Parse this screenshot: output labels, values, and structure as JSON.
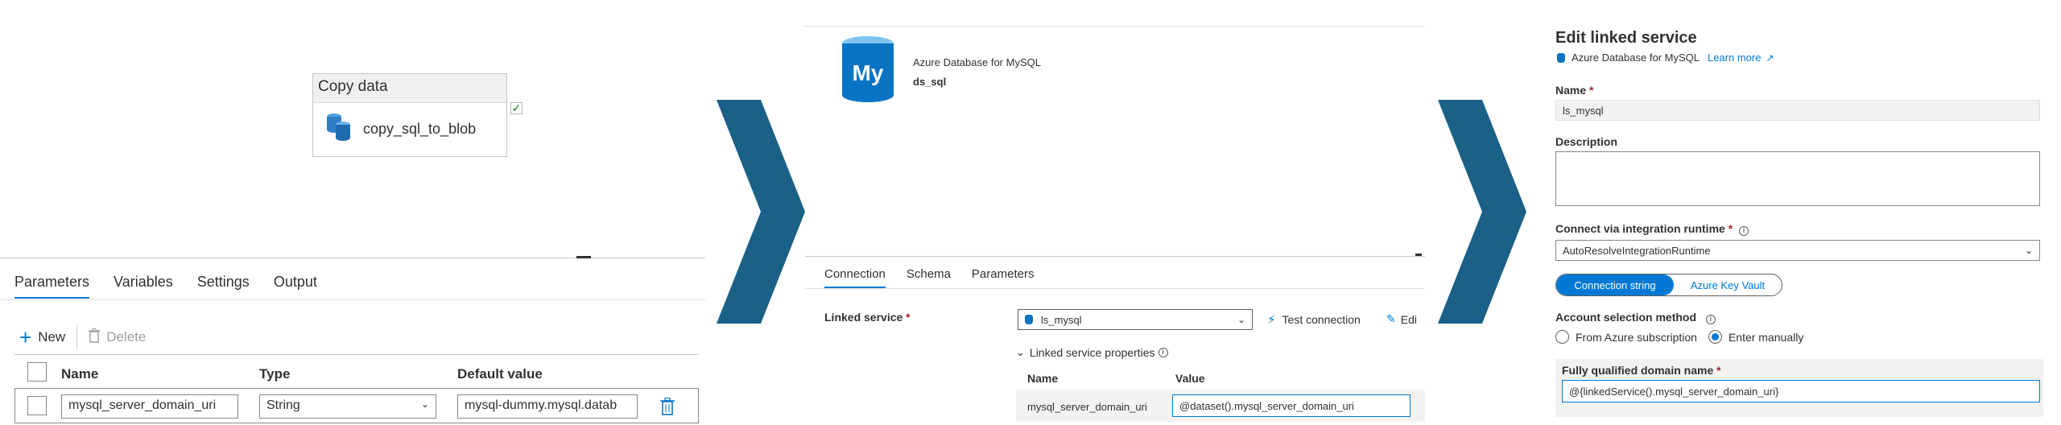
{
  "pipeline": {
    "activity_header": "Copy data",
    "activity_name": "copy_sql_to_blob",
    "status_icon": "check-icon",
    "tabs": [
      "Parameters",
      "Variables",
      "Settings",
      "Output"
    ],
    "toolbar": {
      "new_label": "New",
      "delete_label": "Delete"
    },
    "grid": {
      "headers": [
        "Name",
        "Type",
        "Default value"
      ],
      "row": {
        "name": "mysql_server_domain_uri",
        "type": "String",
        "default": "mysql-dummy.mysql.datab"
      }
    }
  },
  "dataset": {
    "logo_text": "My",
    "type_label": "Azure Database for MySQL",
    "name": "ds_sql",
    "tabs": [
      "Connection",
      "Schema",
      "Parameters"
    ],
    "linked_service_label": "Linked service",
    "linked_service_value": "ls_mysql",
    "test_connection": "Test connection",
    "edit": "Edi",
    "props_toggle": "Linked service properties",
    "props_headers": [
      "Name",
      "Value"
    ],
    "props_row": {
      "name": "mysql_server_domain_uri",
      "value": "@dataset().mysql_server_domain_uri"
    }
  },
  "linked_service": {
    "title": "Edit linked service",
    "type_label": "Azure Database for MySQL",
    "learn_more": "Learn more",
    "name_label": "Name",
    "name_value": "ls_mysql",
    "description_label": "Description",
    "runtime_label": "Connect via integration runtime",
    "runtime_value": "AutoResolveIntegrationRuntime",
    "toggle": [
      "Connection string",
      "Azure Key Vault"
    ],
    "account_label": "Account selection method",
    "account_options": [
      "From Azure subscription",
      "Enter manually"
    ],
    "fqdn_label": "Fully qualified domain name",
    "fqdn_value": "@{linkedService().mysql_server_domain_uri}"
  },
  "colors": {
    "accent": "#0078d4",
    "chevron": "#1a6087",
    "required": "#a4262c"
  }
}
